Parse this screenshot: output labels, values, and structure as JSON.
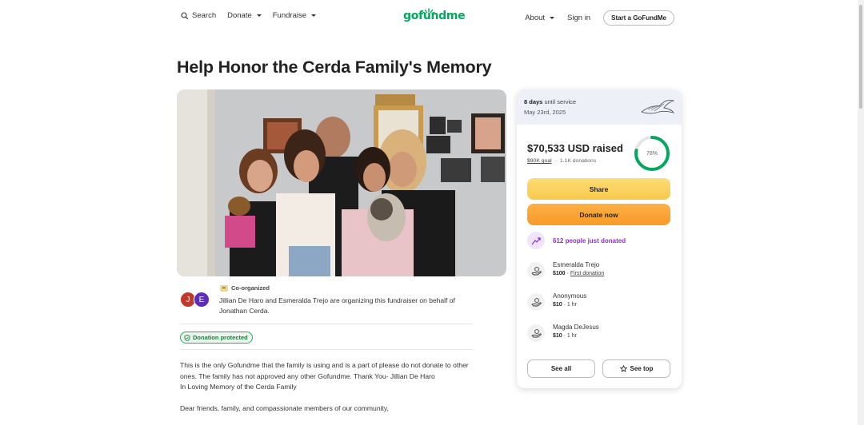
{
  "nav": {
    "search_label": "Search",
    "donate_label": "Donate",
    "fundraise_label": "Fundraise",
    "logo_text": "gofundme",
    "about_label": "About",
    "signin_label": "Sign in",
    "start_label": "Start a GoFundMe"
  },
  "campaign": {
    "title": "Help Honor the Cerda Family's Memory"
  },
  "organizer": {
    "avatar_1": "J",
    "avatar_2": "E",
    "badge": "Co-organized",
    "text": "Jillian De Haro and Esmeralda Trejo are organizing this fundraiser on behalf of Jonathan Cerda."
  },
  "protected_label": "Donation protected",
  "description": {
    "p1": "This is the only Gofundme that the family is using and is a part of please do not donate to other ones. The family has not approved any other Gofundme. Thank You- Jillian De Haro",
    "p2": "In Loving Memory of the Cerda Family",
    "p3": "Dear friends, family, and compassionate members of our community,"
  },
  "card": {
    "days_count": "8 days",
    "days_suffix": "until service",
    "date": "May 23rd, 2025",
    "raised": "$70,533 USD raised",
    "goal": "$90K goal",
    "separator": "·",
    "donations": "1.1K donations",
    "progress_percent": 78,
    "progress_label": "78%",
    "share_label": "Share",
    "donate_label": "Donate now",
    "recent_text": "612 people just donated",
    "donors": [
      {
        "name": "Esmeralda Trejo",
        "amount": "$100",
        "meta": "First donation"
      },
      {
        "name": "Anonymous",
        "amount": "$10",
        "meta": "1 hr"
      },
      {
        "name": "Magda DeJesus",
        "amount": "$10",
        "meta": "1 hr"
      }
    ],
    "see_all_label": "See all",
    "see_top_label": "See top"
  },
  "colors": {
    "brand_green": "#02a95c",
    "share_yellow": "#f7c94a",
    "donate_orange": "#f79a2a",
    "purple": "#8b32c7"
  }
}
